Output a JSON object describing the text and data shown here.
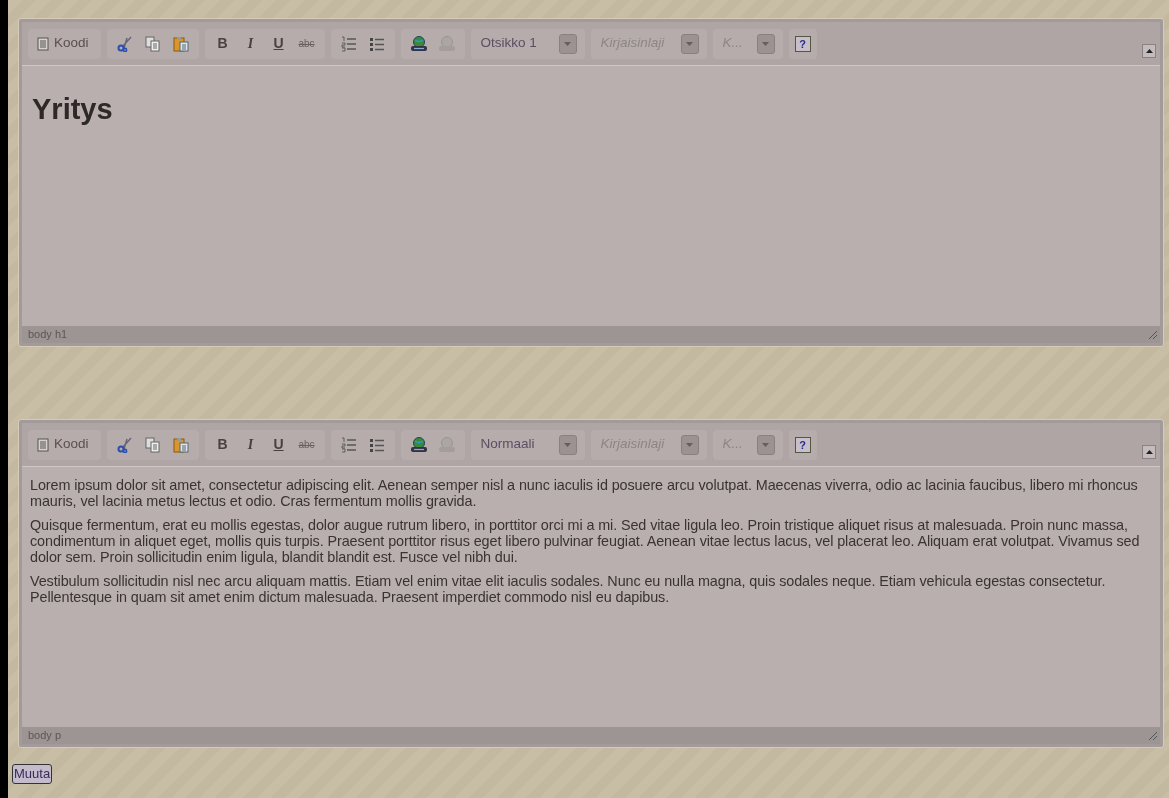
{
  "editors": [
    {
      "toolbar": {
        "groups": [
          [
            {
              "kind": "code",
              "label": "Koodi"
            }
          ],
          [
            {
              "kind": "cut"
            },
            {
              "kind": "copy"
            },
            {
              "kind": "paste"
            }
          ],
          [
            {
              "kind": "bold",
              "label": "B"
            },
            {
              "kind": "italic",
              "label": "I"
            },
            {
              "kind": "underline",
              "label": "U"
            },
            {
              "kind": "strike",
              "label": "abc"
            }
          ],
          [
            {
              "kind": "ordered-list"
            },
            {
              "kind": "bullet-list"
            }
          ],
          [
            {
              "kind": "link",
              "disabled": false
            },
            {
              "kind": "unlink",
              "disabled": true
            }
          ]
        ],
        "format": {
          "value": "Otsikko 1"
        },
        "font": {
          "placeholder": "Kirjaisinlaji"
        },
        "size": {
          "placeholder": "K..."
        },
        "help": "?"
      },
      "content": [
        {
          "kind": "heading",
          "text": "Yritys"
        }
      ],
      "path": "body h1"
    },
    {
      "toolbar": {
        "groups": [
          [
            {
              "kind": "code",
              "label": "Koodi"
            }
          ],
          [
            {
              "kind": "cut"
            },
            {
              "kind": "copy"
            },
            {
              "kind": "paste"
            }
          ],
          [
            {
              "kind": "bold",
              "label": "B"
            },
            {
              "kind": "italic",
              "label": "I"
            },
            {
              "kind": "underline",
              "label": "U"
            },
            {
              "kind": "strike",
              "label": "abc"
            }
          ],
          [
            {
              "kind": "ordered-list"
            },
            {
              "kind": "bullet-list"
            }
          ],
          [
            {
              "kind": "link",
              "disabled": false
            },
            {
              "kind": "unlink",
              "disabled": true
            }
          ]
        ],
        "format": {
          "value": "Normaali"
        },
        "font": {
          "placeholder": "Kirjaisinlaji"
        },
        "size": {
          "placeholder": "K..."
        },
        "help": "?"
      },
      "content": [
        {
          "kind": "paragraph",
          "text": "Lorem ipsum dolor sit amet, consectetur adipiscing elit. Aenean semper nisl a nunc iaculis id posuere arcu volutpat. Maecenas viverra, odio ac lacinia faucibus, libero mi rhoncus mauris, vel lacinia metus lectus et odio. Cras fermentum mollis gravida."
        },
        {
          "kind": "paragraph",
          "text": "Quisque fermentum, erat eu mollis egestas, dolor augue rutrum libero, in porttitor orci mi a mi. Sed vitae ligula leo. Proin tristique aliquet risus at malesuada. Proin nunc massa, condimentum in aliquet eget, mollis quis turpis. Praesent porttitor risus eget libero pulvinar feugiat. Aenean vitae lectus lacus, vel placerat leo. Aliquam erat volutpat. Vivamus sed dolor sem. Proin sollicitudin enim ligula, blandit blandit est. Fusce vel nibh dui."
        },
        {
          "kind": "paragraph",
          "text": "Vestibulum sollicitudin nisl nec arcu aliquam mattis. Etiam vel enim vitae elit iaculis sodales. Nunc eu nulla magna, quis sodales neque. Etiam vehicula egestas consectetur. Pellentesque in quam sit amet enim dictum malesuada. Praesent imperdiet commodo nisl eu dapibus."
        }
      ],
      "path": "body p"
    }
  ],
  "submit_button": "Muuta"
}
